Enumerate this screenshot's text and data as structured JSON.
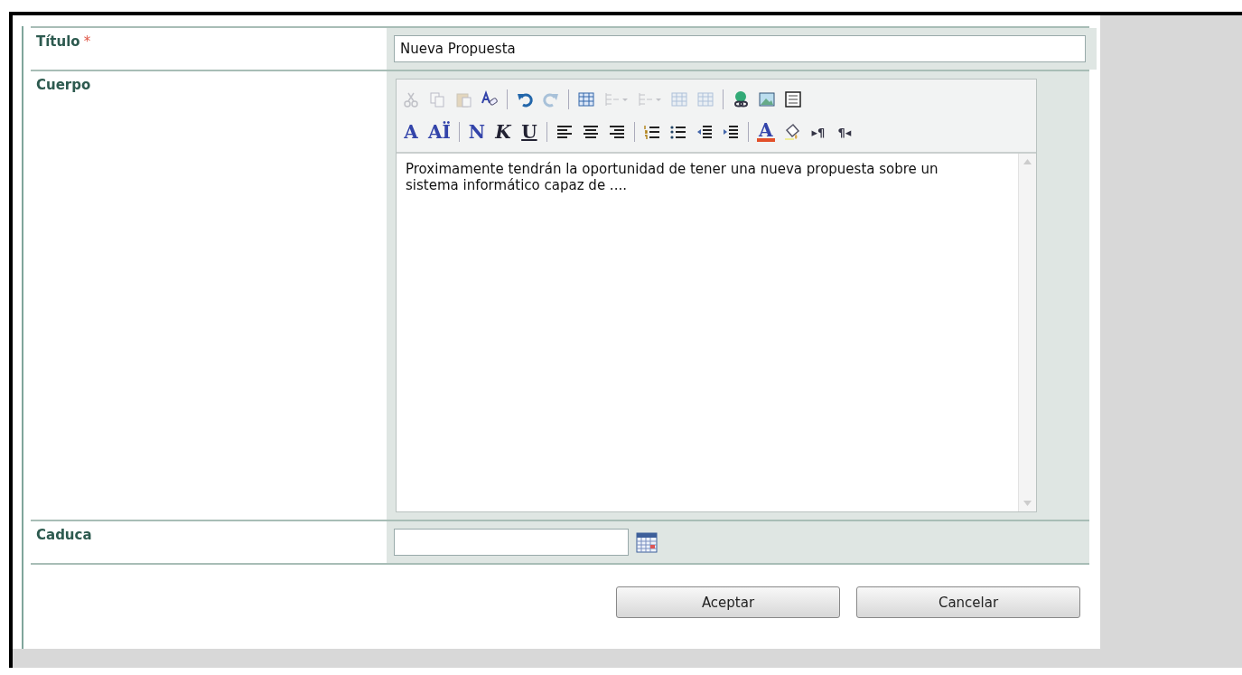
{
  "form": {
    "fields": [
      {
        "kind": "text",
        "label": "Título",
        "required_mark": "*",
        "value": "Nueva Propuesta"
      },
      {
        "kind": "rich",
        "label": "Cuerpo",
        "toolbar": [
          [
            {
              "kind": "cut",
              "disabled": true
            },
            {
              "kind": "copy",
              "disabled": true
            },
            {
              "kind": "paste",
              "disabled": true
            },
            {
              "kind": "spell",
              "disabled": false
            },
            {
              "kind": "separator"
            },
            {
              "kind": "undo",
              "disabled": false
            },
            {
              "kind": "redo",
              "disabled": true
            },
            {
              "kind": "separator"
            },
            {
              "kind": "table",
              "disabled": false
            },
            {
              "kind": "insert-column",
              "disabled": true
            },
            {
              "kind": "insert-row",
              "disabled": true
            },
            {
              "kind": "merge",
              "disabled": true
            },
            {
              "kind": "split",
              "disabled": true
            },
            {
              "kind": "separator"
            },
            {
              "kind": "link",
              "disabled": false
            },
            {
              "kind": "image",
              "disabled": false
            },
            {
              "kind": "source",
              "disabled": false
            }
          ],
          [
            {
              "kind": "glyph",
              "label": "A",
              "disabled": false
            },
            {
              "kind": "glyph",
              "label": "AÏ",
              "disabled": false
            },
            {
              "kind": "separator"
            },
            {
              "kind": "glyph",
              "label": "N",
              "disabled": false
            },
            {
              "kind": "glyph-italic",
              "label": "K",
              "disabled": false
            },
            {
              "kind": "glyph-underline",
              "label": "U",
              "disabled": false
            },
            {
              "kind": "separator"
            },
            {
              "kind": "align-left",
              "disabled": false
            },
            {
              "kind": "align-center",
              "disabled": false
            },
            {
              "kind": "align-right",
              "disabled": false
            },
            {
              "kind": "separator"
            },
            {
              "kind": "numbered-list",
              "disabled": false
            },
            {
              "kind": "bulleted-list",
              "disabled": false
            },
            {
              "kind": "outdent",
              "disabled": false
            },
            {
              "kind": "indent",
              "disabled": false
            },
            {
              "kind": "separator"
            },
            {
              "kind": "text-color",
              "label": "A",
              "disabled": false
            },
            {
              "kind": "fill",
              "disabled": false
            },
            {
              "kind": "glyph-small",
              "label": "▸¶",
              "disabled": false
            },
            {
              "kind": "glyph-small",
              "label": "¶◂",
              "disabled": false
            }
          ]
        ],
        "value": "Proximamente tendrán la oportunidad de tener una nueva propuesta sobre un sistema informático capaz de ...."
      },
      {
        "kind": "date",
        "label": "Caduca"
      }
    ],
    "buttons": [
      "Aceptar",
      "Cancelar"
    ]
  }
}
